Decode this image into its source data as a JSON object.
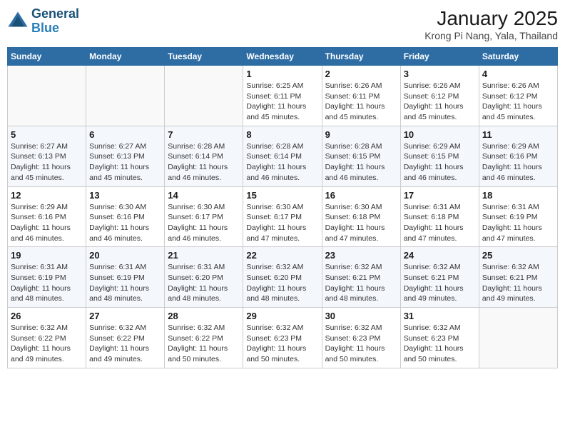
{
  "header": {
    "logo_line1": "General",
    "logo_line2": "Blue",
    "title": "January 2025",
    "subtitle": "Krong Pi Nang, Yala, Thailand"
  },
  "weekdays": [
    "Sunday",
    "Monday",
    "Tuesday",
    "Wednesday",
    "Thursday",
    "Friday",
    "Saturday"
  ],
  "weeks": [
    [
      {
        "day": "",
        "info": ""
      },
      {
        "day": "",
        "info": ""
      },
      {
        "day": "",
        "info": ""
      },
      {
        "day": "1",
        "info": "Sunrise: 6:25 AM\nSunset: 6:11 PM\nDaylight: 11 hours\nand 45 minutes."
      },
      {
        "day": "2",
        "info": "Sunrise: 6:26 AM\nSunset: 6:11 PM\nDaylight: 11 hours\nand 45 minutes."
      },
      {
        "day": "3",
        "info": "Sunrise: 6:26 AM\nSunset: 6:12 PM\nDaylight: 11 hours\nand 45 minutes."
      },
      {
        "day": "4",
        "info": "Sunrise: 6:26 AM\nSunset: 6:12 PM\nDaylight: 11 hours\nand 45 minutes."
      }
    ],
    [
      {
        "day": "5",
        "info": "Sunrise: 6:27 AM\nSunset: 6:13 PM\nDaylight: 11 hours\nand 45 minutes."
      },
      {
        "day": "6",
        "info": "Sunrise: 6:27 AM\nSunset: 6:13 PM\nDaylight: 11 hours\nand 45 minutes."
      },
      {
        "day": "7",
        "info": "Sunrise: 6:28 AM\nSunset: 6:14 PM\nDaylight: 11 hours\nand 46 minutes."
      },
      {
        "day": "8",
        "info": "Sunrise: 6:28 AM\nSunset: 6:14 PM\nDaylight: 11 hours\nand 46 minutes."
      },
      {
        "day": "9",
        "info": "Sunrise: 6:28 AM\nSunset: 6:15 PM\nDaylight: 11 hours\nand 46 minutes."
      },
      {
        "day": "10",
        "info": "Sunrise: 6:29 AM\nSunset: 6:15 PM\nDaylight: 11 hours\nand 46 minutes."
      },
      {
        "day": "11",
        "info": "Sunrise: 6:29 AM\nSunset: 6:16 PM\nDaylight: 11 hours\nand 46 minutes."
      }
    ],
    [
      {
        "day": "12",
        "info": "Sunrise: 6:29 AM\nSunset: 6:16 PM\nDaylight: 11 hours\nand 46 minutes."
      },
      {
        "day": "13",
        "info": "Sunrise: 6:30 AM\nSunset: 6:16 PM\nDaylight: 11 hours\nand 46 minutes."
      },
      {
        "day": "14",
        "info": "Sunrise: 6:30 AM\nSunset: 6:17 PM\nDaylight: 11 hours\nand 46 minutes."
      },
      {
        "day": "15",
        "info": "Sunrise: 6:30 AM\nSunset: 6:17 PM\nDaylight: 11 hours\nand 47 minutes."
      },
      {
        "day": "16",
        "info": "Sunrise: 6:30 AM\nSunset: 6:18 PM\nDaylight: 11 hours\nand 47 minutes."
      },
      {
        "day": "17",
        "info": "Sunrise: 6:31 AM\nSunset: 6:18 PM\nDaylight: 11 hours\nand 47 minutes."
      },
      {
        "day": "18",
        "info": "Sunrise: 6:31 AM\nSunset: 6:19 PM\nDaylight: 11 hours\nand 47 minutes."
      }
    ],
    [
      {
        "day": "19",
        "info": "Sunrise: 6:31 AM\nSunset: 6:19 PM\nDaylight: 11 hours\nand 48 minutes."
      },
      {
        "day": "20",
        "info": "Sunrise: 6:31 AM\nSunset: 6:19 PM\nDaylight: 11 hours\nand 48 minutes."
      },
      {
        "day": "21",
        "info": "Sunrise: 6:31 AM\nSunset: 6:20 PM\nDaylight: 11 hours\nand 48 minutes."
      },
      {
        "day": "22",
        "info": "Sunrise: 6:32 AM\nSunset: 6:20 PM\nDaylight: 11 hours\nand 48 minutes."
      },
      {
        "day": "23",
        "info": "Sunrise: 6:32 AM\nSunset: 6:21 PM\nDaylight: 11 hours\nand 48 minutes."
      },
      {
        "day": "24",
        "info": "Sunrise: 6:32 AM\nSunset: 6:21 PM\nDaylight: 11 hours\nand 49 minutes."
      },
      {
        "day": "25",
        "info": "Sunrise: 6:32 AM\nSunset: 6:21 PM\nDaylight: 11 hours\nand 49 minutes."
      }
    ],
    [
      {
        "day": "26",
        "info": "Sunrise: 6:32 AM\nSunset: 6:22 PM\nDaylight: 11 hours\nand 49 minutes."
      },
      {
        "day": "27",
        "info": "Sunrise: 6:32 AM\nSunset: 6:22 PM\nDaylight: 11 hours\nand 49 minutes."
      },
      {
        "day": "28",
        "info": "Sunrise: 6:32 AM\nSunset: 6:22 PM\nDaylight: 11 hours\nand 50 minutes."
      },
      {
        "day": "29",
        "info": "Sunrise: 6:32 AM\nSunset: 6:23 PM\nDaylight: 11 hours\nand 50 minutes."
      },
      {
        "day": "30",
        "info": "Sunrise: 6:32 AM\nSunset: 6:23 PM\nDaylight: 11 hours\nand 50 minutes."
      },
      {
        "day": "31",
        "info": "Sunrise: 6:32 AM\nSunset: 6:23 PM\nDaylight: 11 hours\nand 50 minutes."
      },
      {
        "day": "",
        "info": ""
      }
    ]
  ]
}
